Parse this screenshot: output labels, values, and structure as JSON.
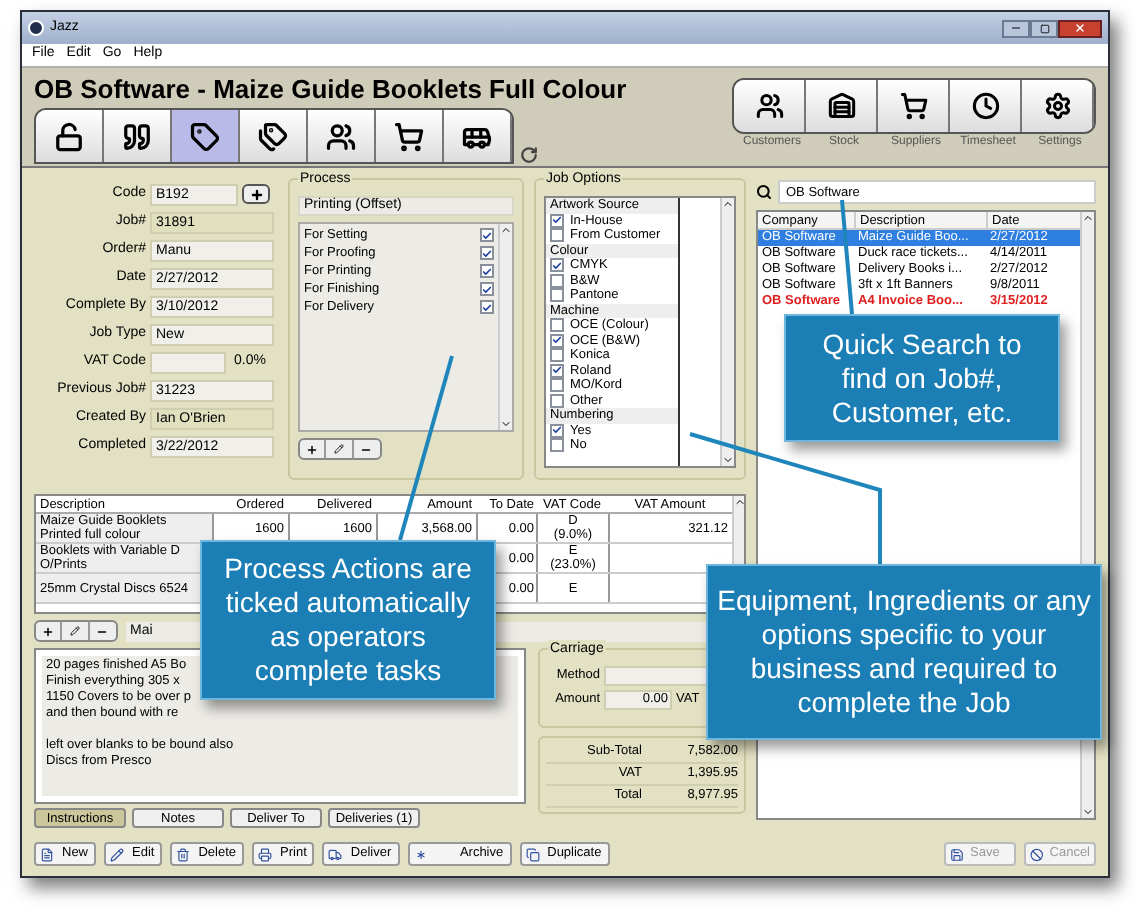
{
  "window": {
    "title": "Jazz"
  },
  "menu": [
    "File",
    "Edit",
    "Go",
    "Help"
  ],
  "header_title": "OB Software - Maize Guide Booklets Full Colour",
  "toolbar_tabs": [
    {
      "kind": "unlock",
      "selected": false
    },
    {
      "kind": "quote",
      "selected": false
    },
    {
      "kind": "tag",
      "selected": true
    },
    {
      "kind": "tags",
      "selected": false
    },
    {
      "kind": "contacts",
      "selected": false
    },
    {
      "kind": "cart",
      "selected": false
    },
    {
      "kind": "vehicle",
      "selected": false
    }
  ],
  "nav_buttons": [
    {
      "kind": "customers",
      "label": "Customers"
    },
    {
      "kind": "stock",
      "label": "Stock"
    },
    {
      "kind": "suppliers",
      "label": "Suppliers"
    },
    {
      "kind": "timesheet",
      "label": "Timesheet"
    },
    {
      "kind": "settings",
      "label": "Settings"
    }
  ],
  "fields": [
    {
      "label": "Code",
      "value": "B192",
      "kind": "add",
      "readonly": false
    },
    {
      "label": "Job#",
      "value": "31891",
      "kind": "plain",
      "readonly": true
    },
    {
      "label": "Order#",
      "value": "Manu",
      "kind": "plain",
      "readonly": false
    },
    {
      "label": "Date",
      "value": "2/27/2012",
      "kind": "plain",
      "readonly": false
    },
    {
      "label": "Complete By",
      "value": "3/10/2012",
      "kind": "plain",
      "readonly": false
    },
    {
      "label": "Job Type",
      "value": "New",
      "kind": "plain",
      "readonly": false
    },
    {
      "label": "VAT Code",
      "suffix": "0.0%",
      "kind": "suffix",
      "readonly": false
    },
    {
      "label": "Previous Job#",
      "value": "31223",
      "kind": "plain",
      "readonly": false
    },
    {
      "label": "Created By",
      "value": "Ian O'Brien",
      "kind": "plain",
      "readonly": true
    },
    {
      "label": "Completed",
      "value": "3/22/2012",
      "kind": "plain",
      "readonly": false
    }
  ],
  "process": {
    "title": "Process",
    "method": "Printing (Offset)",
    "actions": [
      {
        "label": "For Setting",
        "checked": true
      },
      {
        "label": "For Proofing",
        "checked": true
      },
      {
        "label": "For Printing",
        "checked": true
      },
      {
        "label": "For Finishing",
        "checked": true
      },
      {
        "label": "For Delivery",
        "checked": true
      }
    ]
  },
  "job_options": {
    "title": "Job Options",
    "groups": [
      {
        "heading": "Artwork Source",
        "options": [
          {
            "label": "In-House",
            "checked": true
          },
          {
            "label": "From Customer",
            "checked": false
          }
        ]
      },
      {
        "heading": "Colour",
        "options": [
          {
            "label": "CMYK",
            "checked": true
          },
          {
            "label": "B&W",
            "checked": false
          },
          {
            "label": "Pantone",
            "checked": false
          }
        ]
      },
      {
        "heading": "Machine",
        "options": [
          {
            "label": "OCE (Colour)",
            "checked": false
          },
          {
            "label": "OCE (B&W)",
            "checked": true
          },
          {
            "label": "Konica",
            "checked": false
          },
          {
            "label": "Roland",
            "checked": true
          },
          {
            "label": "MO/Kord",
            "checked": false
          },
          {
            "label": "Other",
            "checked": false
          }
        ]
      },
      {
        "heading": "Numbering",
        "options": [
          {
            "label": "Yes",
            "checked": true
          },
          {
            "label": "No",
            "checked": false
          }
        ]
      }
    ]
  },
  "search": {
    "value": "OB Software"
  },
  "results": {
    "columns": [
      "Company",
      "Description",
      "Date"
    ],
    "rows": [
      {
        "company": "OB Software",
        "description": "Maize Guide Boo...",
        "date": "2/27/2012",
        "selected": true,
        "flagged": false
      },
      {
        "company": "OB Software",
        "description": "Duck race tickets...",
        "date": "4/14/2011",
        "selected": false,
        "flagged": false
      },
      {
        "company": "OB Software",
        "description": "Delivery Books i...",
        "date": "2/27/2012",
        "selected": false,
        "flagged": false
      },
      {
        "company": "OB Software",
        "description": "3ft x 1ft Banners",
        "date": "9/8/2011",
        "selected": false,
        "flagged": false
      },
      {
        "company": "OB Software",
        "description": "A4 Invoice Boo...",
        "date": "3/15/2012",
        "selected": false,
        "flagged": true
      }
    ]
  },
  "line_items": {
    "columns": [
      "Description",
      "Ordered",
      "Delivered",
      "Amount",
      "To Date",
      "VAT Code",
      "VAT Amount"
    ],
    "rows": [
      {
        "description": [
          "Maize Guide Booklets",
          "Printed full colour"
        ],
        "ordered": "1600",
        "delivered": "1600",
        "amount": "3,568.00",
        "to_date": "0.00",
        "vat_code": [
          "D",
          "(9.0%)"
        ],
        "vat_amount": "321.12"
      },
      {
        "description": [
          "Booklets with Variable D",
          "O/Prints"
        ],
        "to_date": "0.00",
        "vat_code": [
          "E",
          "(23.0%)"
        ]
      },
      {
        "description": [
          "25mm Crystal Discs 6524"
        ],
        "to_date": "0.00",
        "vat_code": [
          "E"
        ]
      }
    ]
  },
  "item_field": {
    "value": "Mai"
  },
  "instructions": [
    [
      "20 pages finished A5 Bo",
      "Finish everything 305 x",
      "1150 Covers to be over p",
      "and then bound with re"
    ],
    [
      "left over blanks to be bound also",
      "Discs from Presco"
    ]
  ],
  "bottom_tabs": [
    {
      "label": "Instructions",
      "selected": true
    },
    {
      "label": "Notes",
      "selected": false
    },
    {
      "label": "Deliver To",
      "selected": false
    },
    {
      "label": "Deliveries (1)",
      "selected": false
    }
  ],
  "carriage": {
    "title": "Carriage",
    "method_label": "Method",
    "amount_label": "Amount",
    "amount": "0.00",
    "vat_label": "VAT"
  },
  "totals": [
    {
      "label": "Sub-Total",
      "value": "7,582.00"
    },
    {
      "label": "VAT",
      "value": "1,395.95"
    },
    {
      "label": "Total",
      "value": "8,977.95"
    }
  ],
  "actions": [
    {
      "kind": "new",
      "label": "New",
      "disabled": false
    },
    {
      "kind": "edit",
      "label": "Edit",
      "disabled": false
    },
    {
      "kind": "delete",
      "label": "Delete",
      "disabled": false
    },
    {
      "kind": "print",
      "label": "Print",
      "disabled": false
    },
    {
      "kind": "deliver",
      "label": "Deliver",
      "disabled": false
    },
    {
      "kind": "archive",
      "label": "Archive",
      "disabled": false
    },
    {
      "kind": "duplicate",
      "label": "Duplicate",
      "disabled": false
    }
  ],
  "form_actions": [
    {
      "kind": "save",
      "label": "Save",
      "disabled": true
    },
    {
      "kind": "cancel",
      "label": "Cancel",
      "disabled": true
    }
  ],
  "callouts": [
    {
      "text": "Quick Search to find on Job#, Customer, etc."
    },
    {
      "text": "Process Actions are ticked automatically as operators complete tasks"
    },
    {
      "text": "Equipment, Ingredients or any options specific to your business and required to complete the Job"
    }
  ]
}
